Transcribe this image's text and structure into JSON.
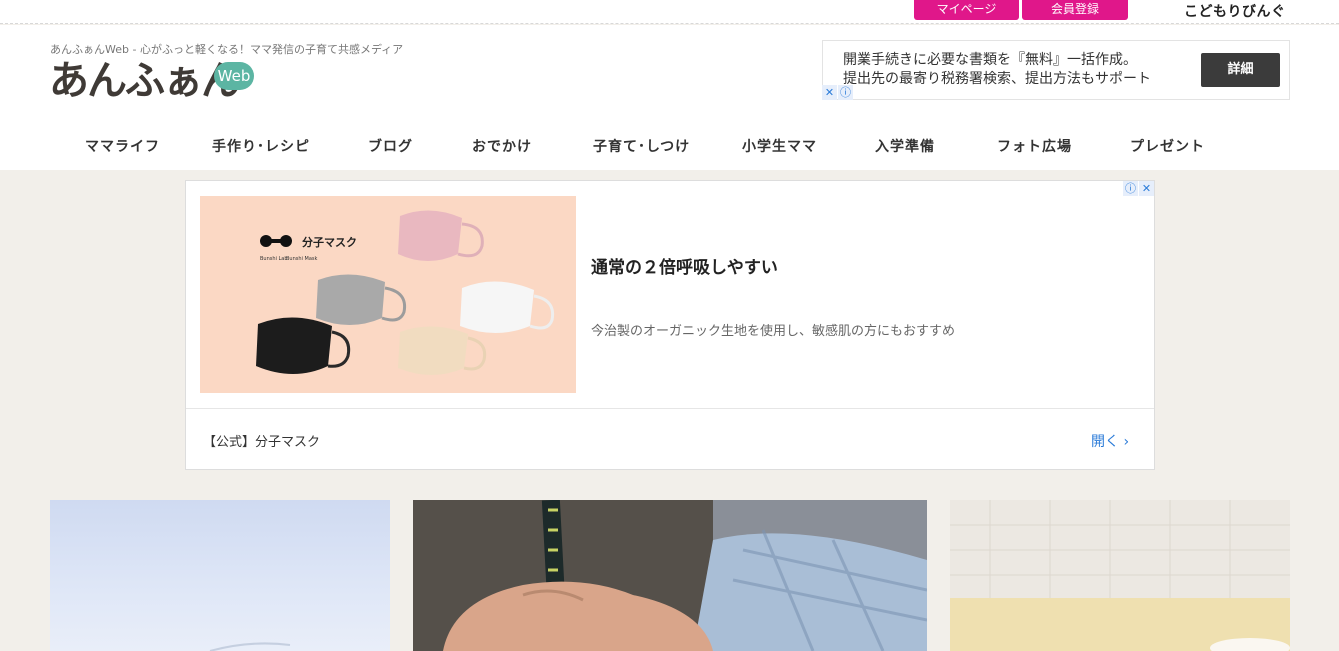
{
  "topbar": {
    "mypage_label": "マイページ",
    "signup_label": "会員登録",
    "brand_link": "こどもりびんぐ",
    "accent_color": "#e0178a"
  },
  "header": {
    "tagline": "あんふぁんWeb - 心がふっと軽くなる！ママ発信の子育て共感メディア",
    "logo_text": "あんふぁん",
    "logo_badge": "Web",
    "logo_badge_color": "#5cb5a3"
  },
  "top_ad": {
    "line1": "開業手続きに必要な書類を『無料』一括作成。",
    "line2": "提出先の最寄り税務署検索、提出方法もサポート",
    "button_label": "詳細",
    "close_icon": "✕",
    "info_icon": "ⓘ"
  },
  "nav": {
    "items": [
      "ママライフ",
      "手作り･レシピ",
      "ブログ",
      "おでかけ",
      "子育て･しつけ",
      "小学生ママ",
      "入学準備",
      "フォト広場",
      "プレゼント"
    ]
  },
  "ad_card": {
    "headline": "通常の２倍呼吸しやすい",
    "description": "今治製のオーガニック生地を使用し、敏感肌の方にもおすすめ",
    "sponsor": "【公式】分子マスク",
    "open_label": "開く ›",
    "image": {
      "brand_title": "分子マスク",
      "brand_sub1": "Bunshi Lab",
      "brand_sub2": "Bunshi Mask",
      "background_color": "#fbd8c4"
    }
  },
  "articles": [
    {
      "image": "sky-photo"
    },
    {
      "image": "child-writing-with-pencil-photo"
    },
    {
      "image": "tiled-wall-and-table-photo"
    }
  ]
}
